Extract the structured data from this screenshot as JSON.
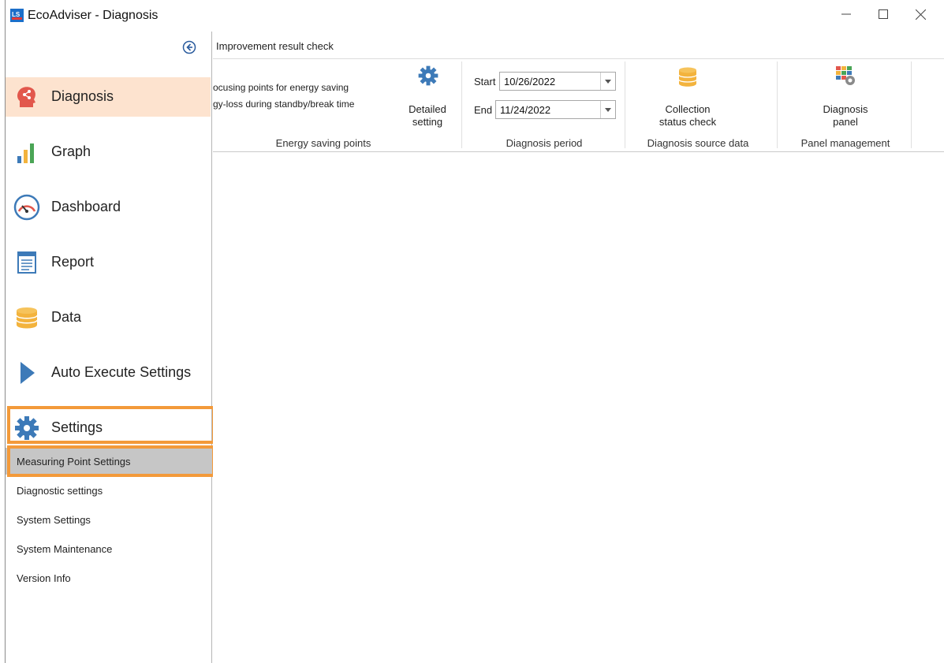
{
  "window": {
    "title": "EcoAdviser - Diagnosis",
    "controls": {
      "minimize": "—",
      "maximize": "☐",
      "close": "✕"
    }
  },
  "sidebar": {
    "nav": [
      {
        "label": "Diagnosis",
        "icon": "head-share-icon",
        "active": true
      },
      {
        "label": "Graph",
        "icon": "bar-chart-icon"
      },
      {
        "label": "Dashboard",
        "icon": "gauge-icon"
      },
      {
        "label": "Report",
        "icon": "document-icon"
      },
      {
        "label": "Data",
        "icon": "database-icon"
      },
      {
        "label": "Auto Execute Settings",
        "icon": "play-triangle-icon"
      },
      {
        "label": "Settings",
        "icon": "gear-icon"
      }
    ],
    "sub_items": [
      {
        "label": "Measuring Point Settings",
        "selected": true
      },
      {
        "label": "Diagnostic settings"
      },
      {
        "label": "System Settings"
      },
      {
        "label": "System Maintenance"
      },
      {
        "label": "Version Info"
      }
    ]
  },
  "ribbon": {
    "tab": "Improvement result check",
    "energy_saving": {
      "line1": "ocusing points for energy saving",
      "line2": "gy-loss during standby/break time",
      "button_line1": "Detailed",
      "button_line2": "setting",
      "group_label": "Energy saving points"
    },
    "period": {
      "start_label": "Start",
      "start_value": "10/26/2022",
      "end_label": "End",
      "end_value": "11/24/2022",
      "group_label": "Diagnosis period"
    },
    "source": {
      "button_line1": "Collection",
      "button_line2": "status check",
      "group_label": "Diagnosis source data"
    },
    "panel": {
      "button_line1": "Diagnosis",
      "button_line2": "panel",
      "group_label": "Panel management"
    }
  },
  "colors": {
    "accent_orange": "#f39a3a",
    "active_bg": "#fde3cf",
    "icon_blue": "#3d7ab8",
    "selected_gray": "#c6c6c6"
  }
}
